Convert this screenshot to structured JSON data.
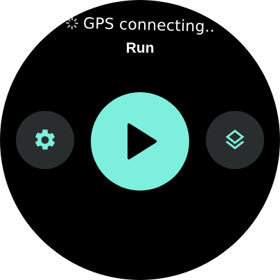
{
  "status": {
    "gps_text": "GPS connecting..",
    "icon": "loading-spinner-icon"
  },
  "activity": {
    "title": "Run"
  },
  "controls": {
    "settings_icon": "gear-icon",
    "start_icon": "play-icon",
    "layers_icon": "layers-icon"
  },
  "colors": {
    "background": "#000000",
    "accent": "#7eeedd",
    "icon_accent": "#7eeedd",
    "side_button": "#2a2d2e",
    "text": "#ffffff"
  }
}
